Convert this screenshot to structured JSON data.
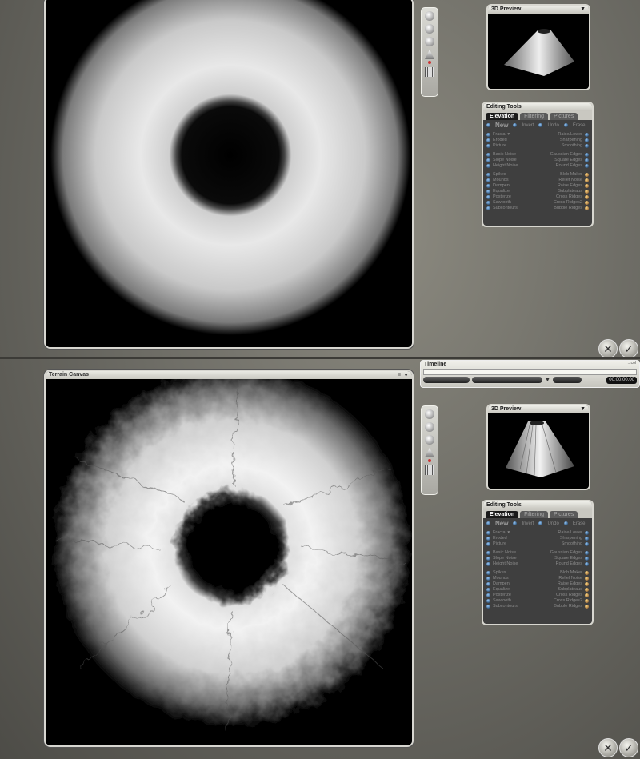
{
  "top": {
    "preview": {
      "title": "3D Preview"
    },
    "editing": {
      "title": "Editing Tools",
      "tabs": [
        "Elevation",
        "Filtering",
        "Pictures"
      ],
      "new_label": "New",
      "actions": [
        "Invert",
        "Undo",
        "Erase"
      ],
      "left_groups": [
        [
          "Fractal ▾",
          "Eroded",
          "Picture"
        ],
        [
          "Basic Noise",
          "Slope Noise",
          "Height Noise"
        ],
        [
          "Spikes",
          "Mounds",
          "Dampen",
          "Equalize",
          "Posterize",
          "Sawtooth",
          "Subcontours"
        ]
      ],
      "right_groups": [
        [
          "Raise/Lower",
          "Sharpening",
          "Smoothing"
        ],
        [
          "Gaussian Edges",
          "Square Edges",
          "Round Edges"
        ],
        [
          "Blob Maker",
          "Relief Noise",
          "Raise Edges",
          "Subplateaus",
          "Cross Ridges",
          "Cross Ridges2",
          "Bubble Ridges"
        ]
      ]
    }
  },
  "bottom": {
    "canvas": {
      "title": "Terrain Canvas",
      "opt": "≡"
    },
    "timeline": {
      "title": "Timeline",
      "right_label": "...col",
      "time": "00:00:00.00"
    },
    "preview": {
      "title": "3D Preview"
    },
    "editing": {
      "title": "Editing Tools",
      "tabs": [
        "Elevation",
        "Filtering",
        "Pictures"
      ],
      "new_label": "New",
      "actions": [
        "Invert",
        "Undo",
        "Erase"
      ],
      "left_groups": [
        [
          "Fractal ▾",
          "Eroded",
          "Picture"
        ],
        [
          "Basic Noise",
          "Slope Noise",
          "Height Noise"
        ],
        [
          "Spikes",
          "Mounds",
          "Dampen",
          "Equalize",
          "Posterize",
          "Sawtooth",
          "Subcontours"
        ]
      ],
      "right_groups": [
        [
          "Raise/Lower",
          "Sharpening",
          "Smoothing"
        ],
        [
          "Gaussian Edges",
          "Square Edges",
          "Round Edges"
        ],
        [
          "Blob Maker",
          "Relief Noise",
          "Raise Edges",
          "Subplateaus",
          "Cross Ridges",
          "Cross Ridges2",
          "Bubble Ridges"
        ]
      ]
    }
  },
  "icons": {
    "cancel": "x-icon",
    "ok": "checkmark-icon"
  }
}
